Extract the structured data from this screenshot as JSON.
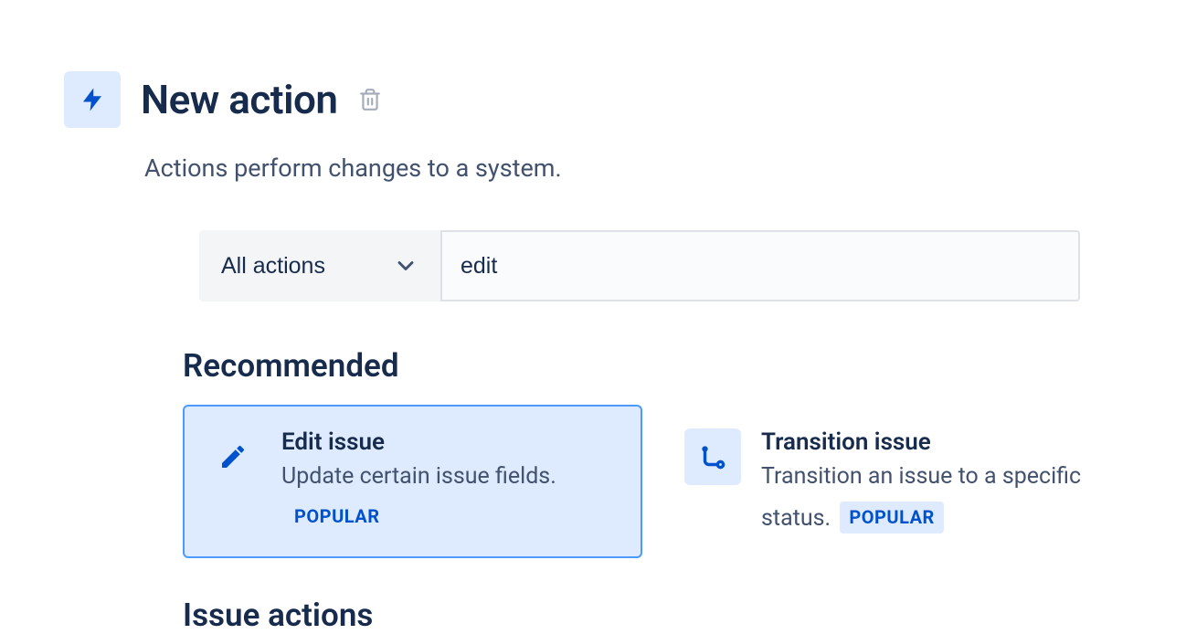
{
  "header": {
    "title": "New action",
    "subtitle": "Actions perform changes to a system."
  },
  "filter": {
    "dropdown_label": "All actions",
    "search_value": "edit"
  },
  "sections": {
    "recommended_heading": "Recommended",
    "issue_actions_heading": "Issue actions"
  },
  "cards": [
    {
      "title": "Edit issue",
      "description": "Update certain issue fields.",
      "badge": "POPULAR"
    },
    {
      "title": "Transition issue",
      "description": "Transition an issue to a specific status.",
      "badge": "POPULAR"
    }
  ]
}
